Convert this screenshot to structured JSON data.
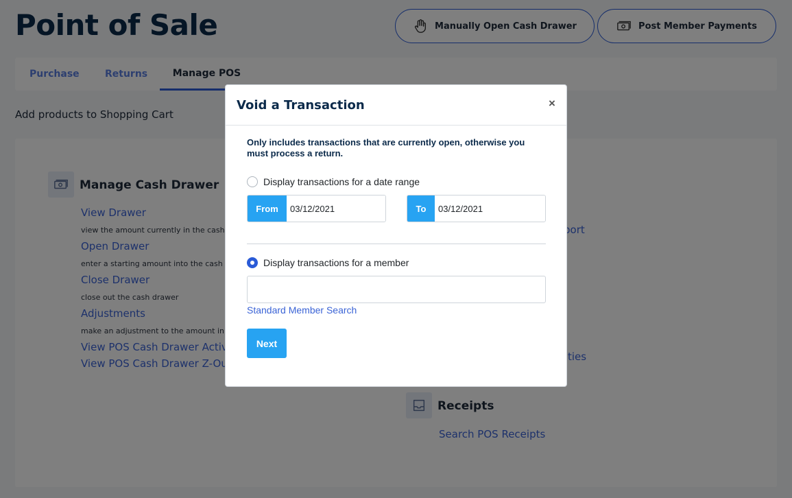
{
  "page": {
    "title": "Point of Sale",
    "subtitle": "Add products to Shopping Cart"
  },
  "header_buttons": {
    "drawer_label": "Manually Open Cash Drawer",
    "drawer_icon": "hand-icon",
    "payments_label": "Post Member Payments",
    "payments_icon": "cash-icon"
  },
  "tabs": [
    {
      "label": "Purchase",
      "active": false
    },
    {
      "label": "Returns",
      "active": false
    },
    {
      "label": "Manage POS",
      "active": true
    }
  ],
  "cash_drawer": {
    "title": "Manage Cash Drawer",
    "icon": "cash-icon",
    "items": [
      {
        "label": "View Drawer",
        "desc": "view the amount currently in the cash"
      },
      {
        "label": "Open Drawer",
        "desc": "enter a starting amount into the cash"
      },
      {
        "label": "Close Drawer",
        "desc": "close out the cash drawer"
      },
      {
        "label": "Adjustments",
        "desc": "make an adjustment to the amount in"
      }
    ],
    "links": [
      "View POS Cash Drawer Activit",
      "View POS Cash Drawer Z-Out"
    ]
  },
  "right_links": {
    "report_fragment": "port",
    "activities_fragment": "ties"
  },
  "receipts": {
    "title": "Receipts",
    "icon": "inbox-tray-icon",
    "link": "Search POS Receipts"
  },
  "modal": {
    "title": "Void a Transaction",
    "close_symbol": "×",
    "note": "Only includes transactions that are currently open, otherwise you must process a return.",
    "date_option_label": "Display transactions for a date range",
    "date_option_checked": false,
    "from_label": "From",
    "from_value": "03/12/2021",
    "to_label": "To",
    "to_value": "03/12/2021",
    "member_option_label": "Display transactions for a member",
    "member_option_checked": true,
    "member_value": "",
    "member_search_link": "Standard Member Search",
    "next_label": "Next"
  },
  "colors": {
    "primary": "#2a5bd7",
    "accent": "#27a3f2",
    "heading": "#0b2a4a",
    "link": "#3a63d6"
  }
}
